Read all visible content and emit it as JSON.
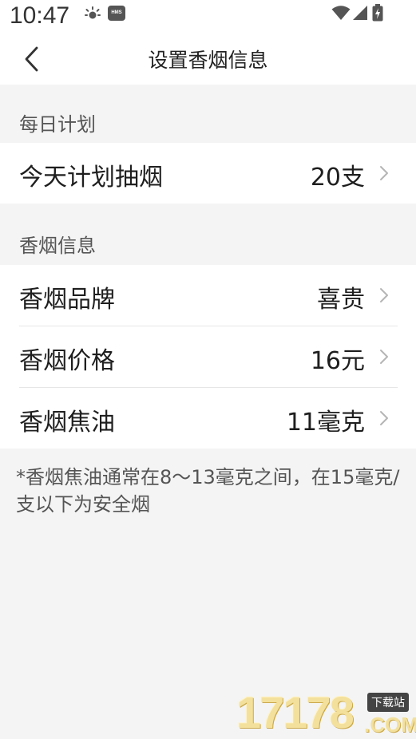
{
  "status_bar": {
    "time": "10:47",
    "icons": [
      "sun-icon",
      "hms-icon",
      "wifi-icon",
      "signal-icon",
      "battery-charging-icon"
    ],
    "hms_label": "HMS"
  },
  "header": {
    "title": "设置香烟信息",
    "back_icon": "chevron-left-icon"
  },
  "daily_plan": {
    "section_title": "每日计划",
    "items": [
      {
        "label": "今天计划抽烟",
        "value": "20支"
      }
    ]
  },
  "cigarette_info": {
    "section_title": "香烟信息",
    "items": [
      {
        "label": "香烟品牌",
        "value": "喜贵"
      },
      {
        "label": "香烟价格",
        "value": "16元"
      },
      {
        "label": "香烟焦油",
        "value": "11毫克"
      }
    ]
  },
  "note": "*香烟焦油通常在8～13毫克之间，在15毫克/支以下为安全烟",
  "watermark": {
    "number": "17178",
    "tag": "下载站",
    "suffix": ".COM"
  },
  "colors": {
    "background": "#f4f4f4",
    "card": "#ffffff",
    "text_primary": "#1e1e1e",
    "text_secondary": "#555555",
    "chevron": "#b5b5b5",
    "divider": "#e6e6e6"
  }
}
